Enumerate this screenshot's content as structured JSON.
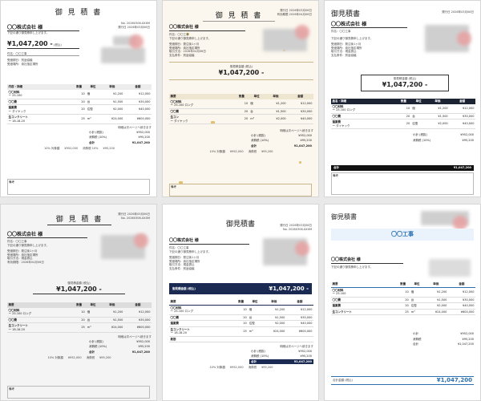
{
  "docs": {
    "c1": {
      "title": "御 見 積 書",
      "no": "No. 20260306-XXXM",
      "date": "発行日 2026年03月06日",
      "customer": "〇〇株式会社 様",
      "intro": "下記の通り御見積申し上げます。",
      "amount": "¥1,047,200 -",
      "amount_note": "(税込)",
      "subject": "件名：〇〇工事",
      "info": [
        "受渡期日：別途協議",
        "受渡場所：貴社指定場所",
        "取引方法：現金振込",
        "有効期限：2026年04月06日"
      ],
      "cols": [
        "内容・詳細",
        "数量",
        "単位",
        "単価",
        "金額"
      ],
      "items": [
        {
          "name": "〇〇材料",
          "sub": "ー 25-100",
          "qty": "10",
          "unit": "個",
          "price": "¥1,200",
          "total": "¥12,000"
        },
        {
          "name": "〇〇費",
          "sub": "",
          "qty": "20",
          "unit": "台",
          "price": "¥1,500",
          "total": "¥30,000"
        },
        {
          "name": "運搬費",
          "sub": "ー ダイヤック",
          "qty": "20",
          "unit": "往復",
          "price": "¥2,000",
          "total": "¥40,000"
        },
        {
          "name": "生コンクリート",
          "sub": "ー 18-18-20",
          "qty": "25",
          "unit": "m³",
          "price": "¥24,000",
          "total": "¥600,000"
        }
      ],
      "carry": "明細は次ページへ続きます",
      "totals": [
        [
          "小計 (税抜)",
          "¥952,000"
        ],
        [
          "消費税 (10%)",
          "¥95,200"
        ],
        [
          "合計",
          "¥1,047,200"
        ]
      ],
      "taxline": [
        "10% 対象額",
        "¥952,000",
        "消費税 10%",
        "¥95,200"
      ],
      "note": "備考"
    },
    "c2": {
      "title": "御 見 積 書",
      "no": "発行日 2026年03月06日",
      "date": "有効期限 2026年04月06日",
      "customer": "〇〇株式会社 様",
      "subject": "件名：〇〇工事",
      "intro": "下記の通り御見積申し上げます。",
      "info": [
        "受渡期日：発注後1ヶ月",
        "受渡場所：貴社指定場所",
        "取引方法：2026年04月06日",
        "支払条件：別途協議",
        "有効期限：2026年04月06日"
      ],
      "amount_label": "御見積金額 (税込)",
      "amount": "¥1,047,200 -",
      "cols": [
        "摘要",
        "数量",
        "単位",
        "単価",
        "金額"
      ],
      "items": [
        {
          "name": "〇〇材料",
          "sub": "ー 25-100 ロング",
          "qty": "10",
          "unit": "個",
          "price": "¥1,200",
          "total": "¥12,000"
        },
        {
          "name": "〇〇費",
          "sub": "",
          "qty": "20",
          "unit": "台",
          "price": "¥1,500",
          "total": "¥30,000"
        },
        {
          "name": "生コン",
          "sub": "ー ダイヤック",
          "qty": "20",
          "unit": "m³",
          "price": "¥2,000",
          "total": "¥40,000"
        }
      ],
      "carry": "明細は次ページへ続きます",
      "totals": [
        [
          "小計 (税抜)",
          "¥952,000"
        ],
        [
          "消費税 (10%)",
          "¥95,200"
        ],
        [
          "合計",
          "¥1,047,200"
        ]
      ],
      "taxline": [
        "10% 対象額",
        "¥952,000",
        "消費税",
        "¥95,200"
      ],
      "note": "備考"
    },
    "c3": {
      "title": "御見積書",
      "date": "発行日 2026年03月06日",
      "customer": "〇〇株式会社 様",
      "subject": "件名：〇〇工事",
      "intro": "下記の通り御見積申し上げます。",
      "info": [
        "受渡期日：発注後1ヶ月",
        "受渡場所：貴社指定場所",
        "取引方法：現金振込",
        "支払条件：別途協議",
        "有効期限：2026年04月06日"
      ],
      "amount_label": "御見積金額 (税込)",
      "amount": "¥1,047,200 -",
      "cols": [
        "品名・詳細",
        "数量",
        "単位",
        "単価",
        "金額"
      ],
      "items": [
        {
          "name": "〇〇材料",
          "sub": "ー 25-100 ロング",
          "qty": "10",
          "unit": "個",
          "price": "¥1,200",
          "total": "¥12,000"
        },
        {
          "name": "〇〇費",
          "sub": "",
          "qty": "20",
          "unit": "台",
          "price": "¥1,500",
          "total": "¥30,000"
        },
        {
          "name": "運搬費",
          "sub": "ー ダイヤック",
          "qty": "20",
          "unit": "往復",
          "price": "¥2,000",
          "total": "¥40,000"
        }
      ],
      "totals": [
        [
          "小計 (税抜)",
          "¥952,000"
        ],
        [
          "消費税 (10%)",
          "¥95,200"
        ],
        [
          "合計",
          "¥1,047,200"
        ]
      ],
      "note": "備考"
    },
    "c4": {
      "title": "御 見 積 書",
      "no": "発行日 2026年03月06日",
      "date": "No. 20260306-XXXM",
      "customer": "〇〇株式会社 様",
      "subject": "件名：〇〇工事",
      "intro": "下記の通り御見積申し上げます。",
      "info": [
        "受渡期日：発注後1ヶ月",
        "受渡場所：貴社指定場所",
        "取引方法：現金振込",
        "有効期限：2026年04月06日",
        "支払条件：別途協議"
      ],
      "amount_label": "御見積金額 (税込)",
      "amount": "¥1,047,200 -",
      "cols": [
        "摘要",
        "数量",
        "単位",
        "単価",
        "金額"
      ],
      "items": [
        {
          "name": "〇〇材料",
          "sub": "ー 25-100 ロング",
          "qty": "10",
          "unit": "個",
          "price": "¥1,200",
          "total": "¥12,000"
        },
        {
          "name": "〇〇費",
          "sub": "",
          "qty": "20",
          "unit": "台",
          "price": "¥1,500",
          "total": "¥30,000"
        },
        {
          "name": "生コンクリート",
          "sub": "ー 18-18-20",
          "qty": "25",
          "unit": "m³",
          "price": "¥24,000",
          "total": "¥600,000"
        }
      ],
      "carry": "明細は次ページへ続きます",
      "totals": [
        [
          "小計 (税抜)",
          "¥952,000"
        ],
        [
          "消費税 (10%)",
          "¥95,200"
        ],
        [
          "合計",
          "¥1,047,200"
        ]
      ],
      "taxline": [
        "10% 対象額",
        "¥952,000",
        "消費税",
        "¥95,200"
      ],
      "note": "備考"
    },
    "c5": {
      "title": "御見積書",
      "no": "発行日 2026年03月06日",
      "date": "No. 20260306-XXXM",
      "customer": "〇〇株式会社 様",
      "subject": "件名：〇〇工事",
      "intro": "下記の通り御見積申し上げます。",
      "info": [
        "受渡期日：発注後1ヶ月",
        "受渡場所：貴社指定場所",
        "取引方法：現金振込",
        "支払条件：別途協議"
      ],
      "amount_label": "御見積金額 (税込)",
      "amount": "¥1,047,200 -",
      "cols": [
        "摘要",
        "数量",
        "単位",
        "単価",
        "金額"
      ],
      "items": [
        {
          "name": "〇〇材料",
          "sub": "ー 25-100 ロング",
          "qty": "10",
          "unit": "個",
          "price": "¥1,200",
          "total": "¥12,000"
        },
        {
          "name": "〇〇費",
          "sub": "",
          "qty": "20",
          "unit": "台",
          "price": "¥1,500",
          "total": "¥30,000"
        },
        {
          "name": "運搬費",
          "sub": "",
          "qty": "20",
          "unit": "往復",
          "price": "¥2,000",
          "total": "¥40,000"
        },
        {
          "name": "生コンクリート",
          "sub": "ー 18-18-20",
          "qty": "25",
          "unit": "m³",
          "price": "¥24,000",
          "total": "¥600,000"
        },
        {
          "name": "鉄筋",
          "sub": "",
          "qty": "",
          "unit": "",
          "price": "",
          "total": ""
        }
      ],
      "carry": "明細は次ページへ続きます",
      "totals": [
        [
          "小計 (税抜)",
          "¥952,000"
        ],
        [
          "消費税 (10%)",
          "¥95,200"
        ],
        [
          "合計",
          "¥1,047,200"
        ]
      ],
      "taxline": [
        "10% 対象額",
        "¥952,000",
        "消費税",
        "¥95,200"
      ]
    },
    "c6": {
      "title": "御見積書",
      "subject": "〇〇工事",
      "customer": "〇〇株式会社 様",
      "intro": "下記の通り御見積申し上げます。",
      "cols": [
        "摘要",
        "数量",
        "単位",
        "単価",
        "金額"
      ],
      "items": [
        {
          "name": "〇〇材料",
          "sub": "ー 25-100",
          "qty": "10",
          "unit": "個",
          "price": "¥1,200",
          "total": "¥12,000"
        },
        {
          "name": "〇〇費",
          "sub": "",
          "qty": "20",
          "unit": "台",
          "price": "¥1,500",
          "total": "¥30,000"
        },
        {
          "name": "運搬費",
          "sub": "",
          "qty": "20",
          "unit": "往復",
          "price": "¥2,000",
          "total": "¥40,000"
        },
        {
          "name": "生コンクリート",
          "sub": "",
          "qty": "25",
          "unit": "m³",
          "price": "¥24,000",
          "total": "¥600,000"
        }
      ],
      "totals": [
        [
          "小計",
          "¥952,000"
        ],
        [
          "消費税",
          "¥95,200"
        ],
        [
          "合計",
          "¥1,047,200"
        ]
      ],
      "grand_label": "合計金額 (税込)",
      "grand": "¥1,047,200"
    }
  },
  "colors": {
    "navy": "#1a2a52",
    "dark": "#1c2434",
    "gold": "#d4aa3a",
    "blue": "#2a6fb0",
    "seal": "#e8a0a0"
  }
}
